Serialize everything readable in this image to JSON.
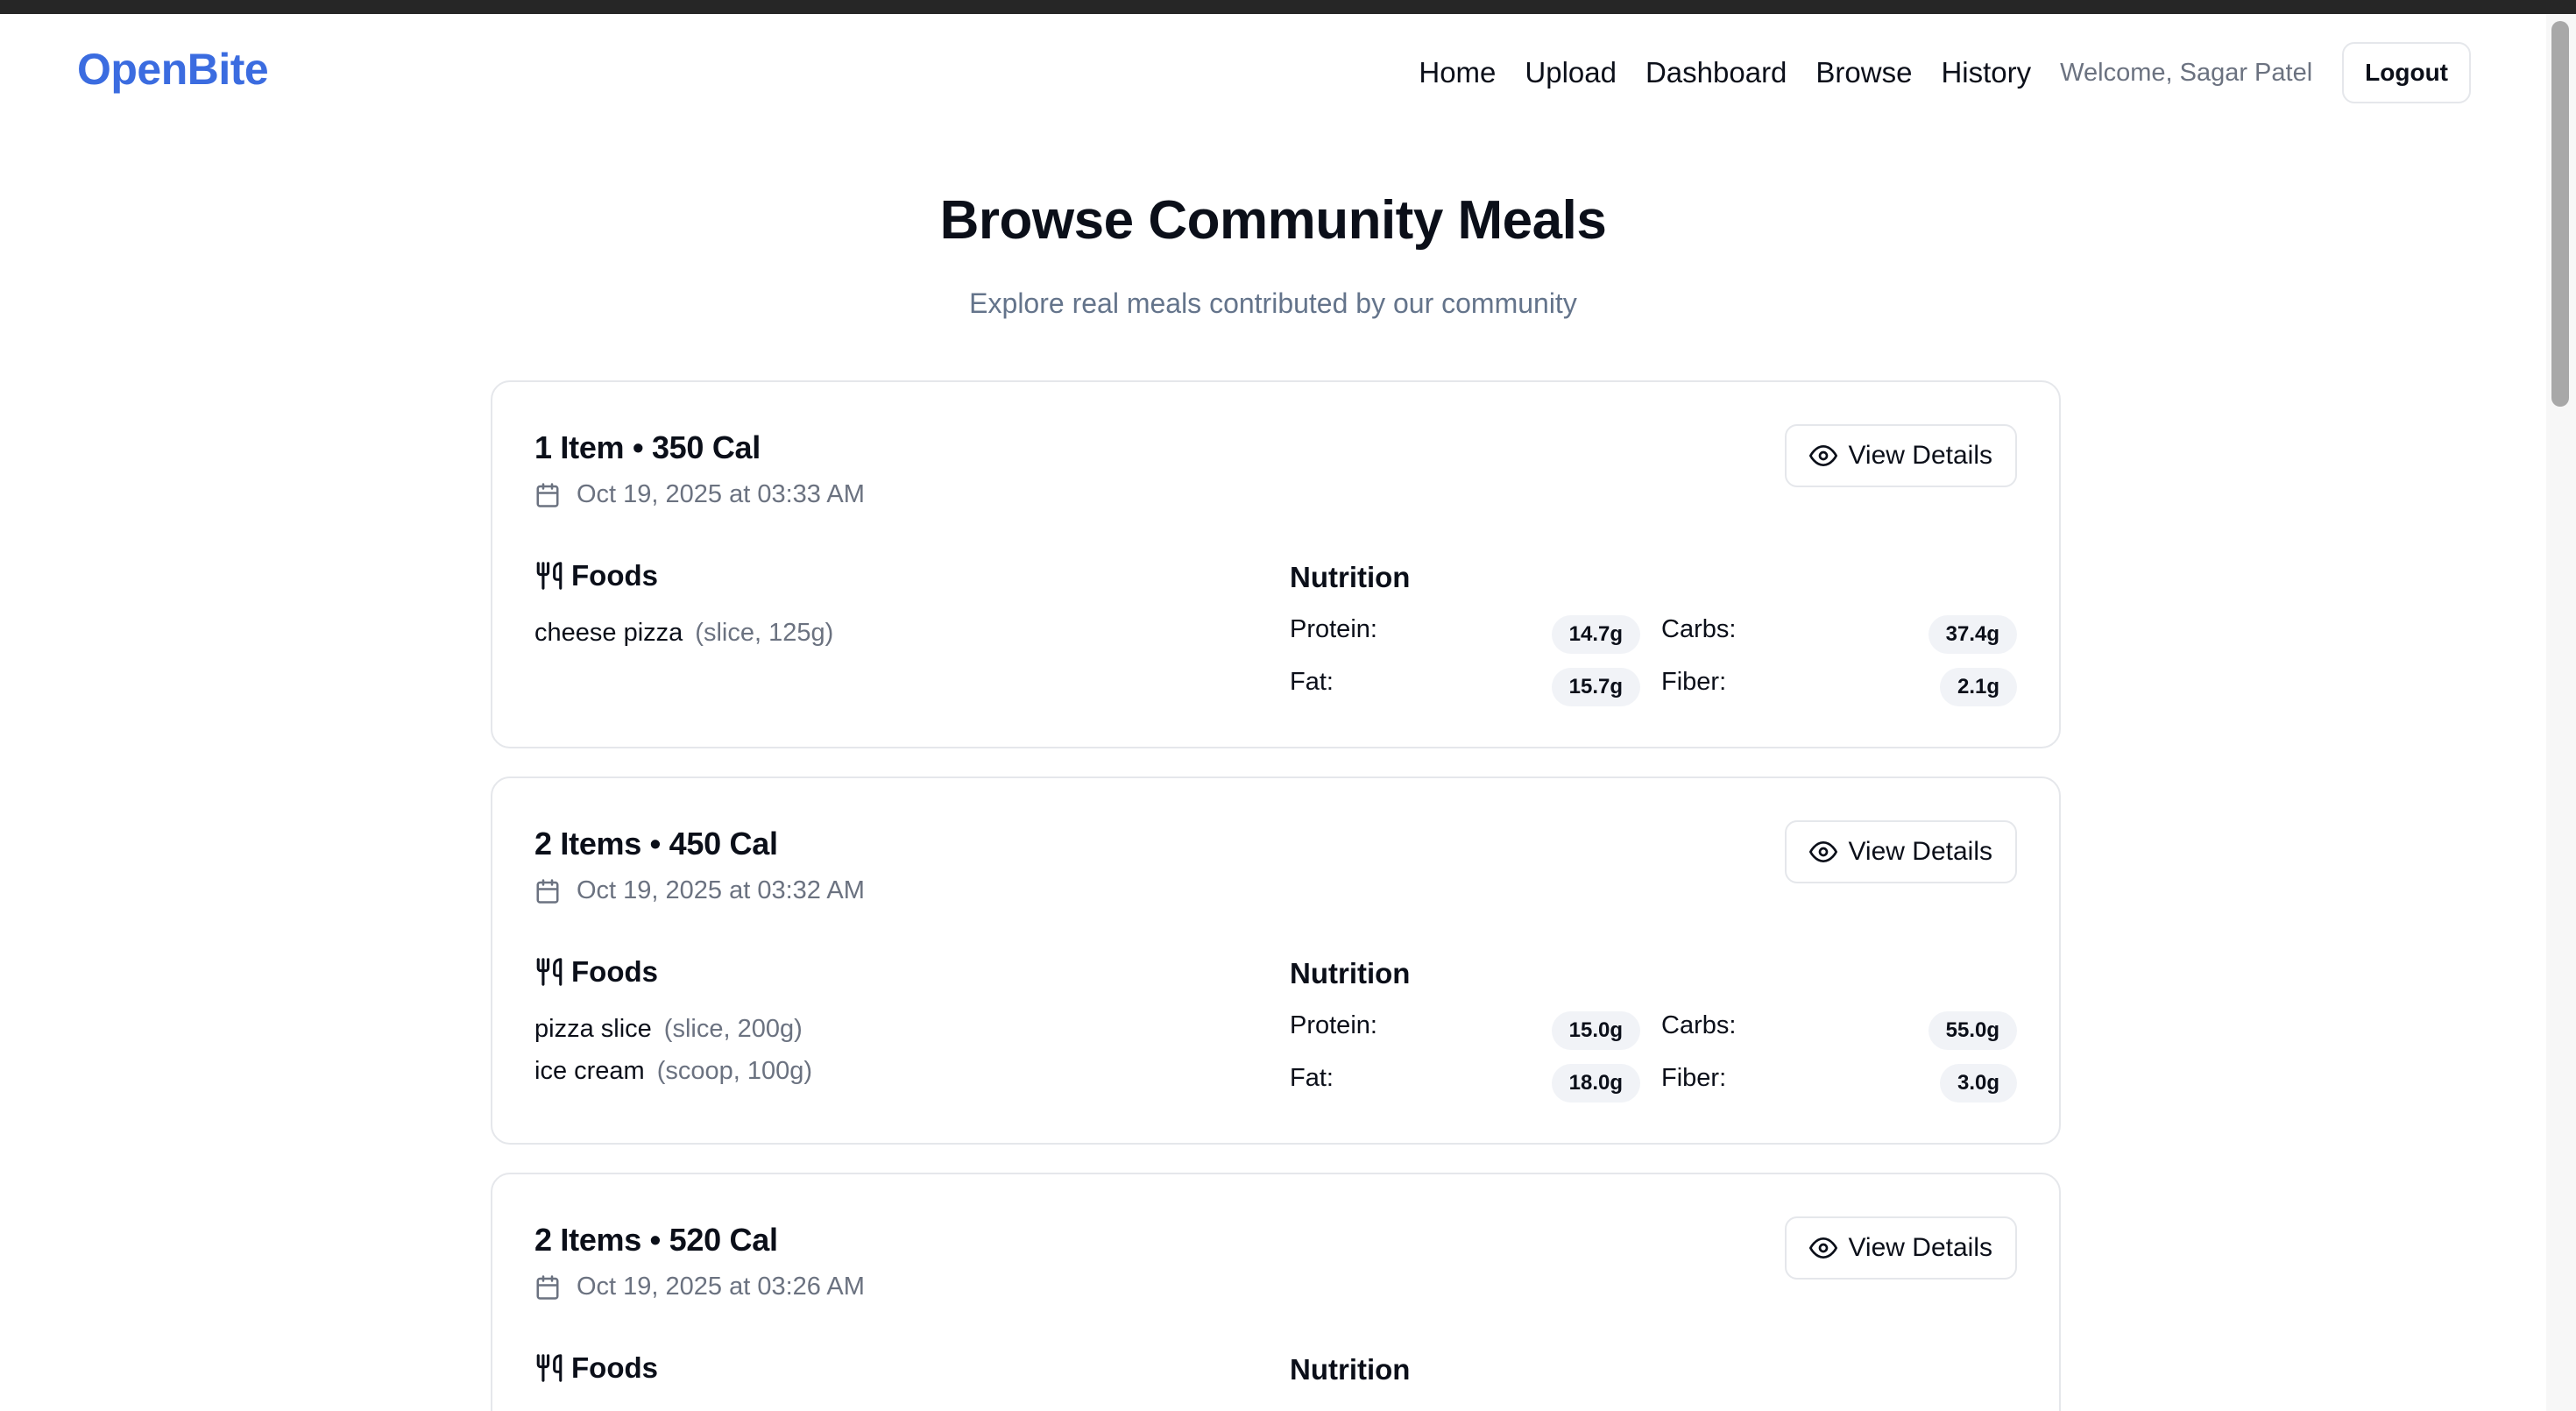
{
  "nav": {
    "logo": "OpenBite",
    "links": [
      "Home",
      "Upload",
      "Dashboard",
      "Browse",
      "History"
    ],
    "welcome": "Welcome, Sagar Patel",
    "logout": "Logout"
  },
  "header": {
    "title": "Browse Community Meals",
    "subtitle": "Explore real meals contributed by our community"
  },
  "labels": {
    "view_details": "View Details",
    "foods": "Foods",
    "nutrition": "Nutrition",
    "protein": "Protein:",
    "carbs": "Carbs:",
    "fat": "Fat:",
    "fiber": "Fiber:"
  },
  "meals": [
    {
      "title": "1 Item • 350 Cal",
      "date": "Oct 19, 2025 at 03:33 AM",
      "foods": [
        {
          "name": "cheese pizza",
          "meta": "(slice, 125g)"
        }
      ],
      "protein": "14.7g",
      "carbs": "37.4g",
      "fat": "15.7g",
      "fiber": "2.1g"
    },
    {
      "title": "2 Items • 450 Cal",
      "date": "Oct 19, 2025 at 03:32 AM",
      "foods": [
        {
          "name": "pizza slice",
          "meta": "(slice, 200g)"
        },
        {
          "name": "ice cream",
          "meta": "(scoop, 100g)"
        }
      ],
      "protein": "15.0g",
      "carbs": "55.0g",
      "fat": "18.0g",
      "fiber": "3.0g"
    },
    {
      "title": "2 Items • 520 Cal",
      "date": "Oct 19, 2025 at 03:26 AM",
      "foods": [],
      "protein": "",
      "carbs": "",
      "fat": "",
      "fiber": ""
    }
  ],
  "icons": {
    "calendar": "calendar-icon",
    "eye": "eye-icon",
    "utensils": "utensils-icon"
  },
  "colors": {
    "brand": "#3b6ce0",
    "muted": "#6b7280",
    "pill_bg": "#f1f3f7"
  }
}
